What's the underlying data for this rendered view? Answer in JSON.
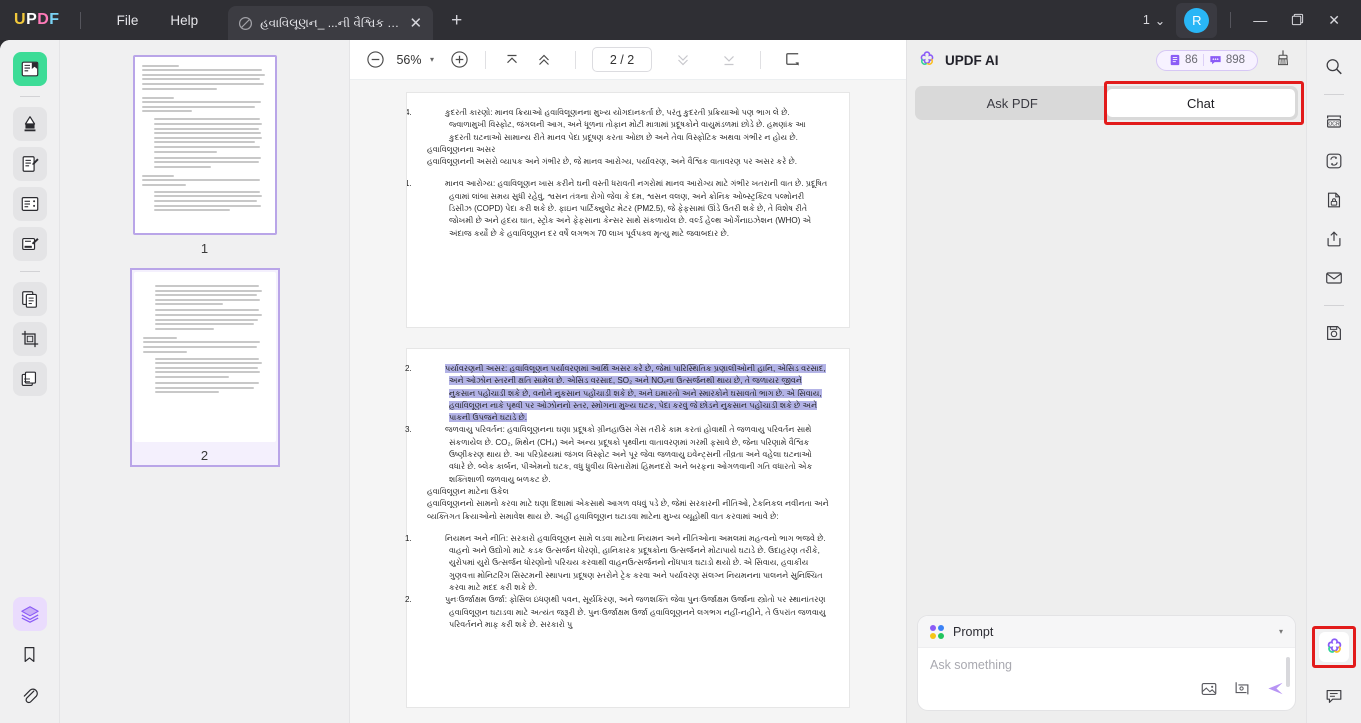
{
  "titlebar": {
    "logo_parts": [
      "U",
      "P",
      "D",
      "F"
    ],
    "menus": [
      {
        "label": "File",
        "name": "menu-file"
      },
      {
        "label": "Help",
        "name": "menu-help"
      }
    ],
    "tab": {
      "title": "હવાવિલૂણન_ ...ની વૈશ્વિક ચિંતા",
      "close_label": "✕",
      "icon": "slash-circle-icon"
    },
    "new_tab_label": "+",
    "window_count": "1",
    "window_count_caret": "⌄",
    "avatar_initial": "R",
    "minimize_label": "—",
    "maximize_label": "❐",
    "close_label": "✕"
  },
  "left_rail": {
    "items": [
      {
        "name": "sidebar-reader-tool",
        "icon": "reader-icon",
        "state": "active"
      },
      {
        "name": "sidebar-annotate-tool",
        "icon": "highlighter-icon",
        "state": "normal"
      },
      {
        "name": "sidebar-edit-pdf-tool",
        "icon": "edit-document-icon",
        "state": "normal"
      },
      {
        "name": "sidebar-form-tool",
        "icon": "form-icon",
        "state": "normal"
      },
      {
        "name": "sidebar-sign-tool",
        "icon": "signature-icon",
        "state": "normal"
      },
      {
        "name": "sidebar-page-tool",
        "icon": "pages-icon",
        "state": "normal"
      },
      {
        "name": "sidebar-crop-tool",
        "icon": "crop-icon",
        "state": "normal"
      },
      {
        "name": "sidebar-organize-tool",
        "icon": "organize-pages-icon",
        "state": "normal"
      }
    ],
    "bottom_items": [
      {
        "name": "sidebar-layers-panel",
        "icon": "layers-icon",
        "state": "purple"
      },
      {
        "name": "sidebar-bookmarks-panel",
        "icon": "bookmark-icon",
        "state": "plain"
      },
      {
        "name": "sidebar-attachments-panel",
        "icon": "paperclip-icon",
        "state": "plain"
      }
    ]
  },
  "thumbnails": {
    "pages": [
      {
        "label": "1",
        "selected": false,
        "name": "thumbnail-page-1"
      },
      {
        "label": "2",
        "selected": true,
        "name": "thumbnail-page-2"
      }
    ]
  },
  "doc_toolbar": {
    "zoom_out_label": "−",
    "zoom_value": "56%",
    "zoom_caret": "▾",
    "zoom_in_label": "+",
    "first_page_icon": "top-of-page-icon",
    "prev_page_icon": "chevron-up-icon",
    "page_indicator": "2 / 2",
    "next_page_icon": "chevron-down-icon",
    "last_page_icon": "bottom-of-page-icon",
    "view_mode_icon": "page-view-mode-icon"
  },
  "document": {
    "page1": {
      "item4": "કુદરતી કારણો: માનવ ક્રિયાઓ હવાવિલૂણનના મુખ્ય યોગદાનકર્તા છે, પરંતુ કુદરતી પ્રક્રિયાઓ પણ ભાગ લે છે. જ્વાળામુખી વિસ્ફોટ, જંગલની આગ, અને ધૂળના તોફાન મોટી માત્રામાં પ્રદૂષકોને વાયુમંડળમાં છોડે છે. હમણાંક આ કુદરતી ઘટનાઓ સામાન્ય રીતે માનવ પેદા પ્રદૂષણ કરતા ઓછા છે અને તેવા વિસ્ફોટિક અથવા ગંભીર ન હોય છે.",
      "heading": "હવાવિલૂણનના અસર",
      "para": "હવાવિલૂણનની અસરો વ્યાપક અને ગંભીર છે, જે માનવ આરોગ્ય, પર્યાવરણ, અને વૈશ્વિક વાતાવરણ પર અસર કરે છે.",
      "item1": "માનવ આરોગ્ય: હવાવિલૂણન ખાસ કરીને ઘની વસ્તી ધરાવતી નગરોમાં માનવ આરોગ્ય માટે ગંભીર ખતરાની વાત છે. પ્રદૂષિત હવામાં લાંબા સમય સુધી રહેવું, શ્વસન તંત્રના રોગો જેવા કે દમ, શ્વસન વલણ, અને ક્રોનિક ઓબ્સ્ટ્રક્ટિવ પલ્મોનરી ડિસીઝ (COPD) પેદા કરી શકે છે. ફાઇન પાર્ટિક્યુલેટ મેટર (PM2.5), જે ફેફસામાં ઊંડે ઉતરી શકે છે, તે વિશેષ રીતે જોખમી છે અને હૃદય ઘાત, સ્ટ્રોક અને ફેફસાના કેન્સર સાથે સંકળાયેલ છે. વર્લ્ડ હેલ્થ ઓર્ગેનાઇઝેશન (WHO) એ અંદાજ કર્યો છે કે હવાવિલૂણન દર વર્ષે લગભગ 70 લાખ પૂર્વપક્વ મૃત્યુ માટે જવાબદાર છે."
    },
    "page2": {
      "item2_highlighted": "પર્યાવરણની અસર: હવાવિલૂણન પર્યાવરણમાં આર્થિ અસર કરે છે, જેમાં પારિસ્થિતિક પ્રણાલીઓની હાનિ, એસિડ વરસાદ, અને ઓઝોન સ્તરની ક્ષતિ સામેલ છે. એસિડ વરસાદ, SO₂ અને NOₓના ઉત્સર્જનથી થાય છે, તે જળાયર જીવને નુકસાન પહોંચાડી શકે છે, વનોને નુકસાન પહોંચાડી શકે છે, અને ઇમારતો અને સ્મારકોને ઘસાવતો ભાગ છે. એ સિવાય, હવાવિલૂણન નાકે પૃથ્વી પર ઓઝોનનો સ્તર, સ્મોગના મુખ્ય ઘટક, પેદા કરવું જે છોડને નુકસાન પહોંચાડી શકે છે અને પાકની ઉપજને ઘટાડે છે.",
      "item3": "જળવાયુ પરિવર્તન: હવાવિલૂણનના ઘણા પ્રદૂષકો ગ્રીનહાઉસ ગેસ તરીકે કામ કરતાં હોવાથી તે જળવાયુ પરિવર્તન સાથે સંકળાયેલ છે. CO₂, મિથેન (CH₄) અને અન્ય પ્રદૂષકો પૃથ્વીના વાતાવરણમાં ગરમી ફસાવે છે, જેના પરિણામે વૈશ્વિક ઉષ્ણીકરણ થાય છે. આ પરિપ્રેક્ષ્યમાં જંગલ વિસ્ફોટ અને પૂર જેવા જળવાયુ ઇવેન્ટ્સની તીવ્રતા અને વહેલા ઘટનાઓ વધારે છે. બ્લેક કાર્બન, પીએમનો ઘટક, વધુ ધ્રુવીય વિસ્તારોમાં હિમનદરો અને બરફના ઓગળવાની ગતિ વધારતો એક શક્તિશાળી જળવાયુ બળકટ છે.",
      "heading": "હવાવિલૂણન માટેના ઉકેલ",
      "para": "હવાવિલૂણનનો સામનો કરવા માટે ઘણા દિશામાં એકસાથે આગળ વધવું પડે છે, જેમાં સરકારની નીતિઓ, ટેકનિકલ નવીનતા અને વ્યક્તિગત ક્રિયાઓનો સમાવેશ થાય છે. અહીં હવાવિલૂણન ઘટાડવા માટેના મુખ્ય વ્યૂહોથી વાત કરવામાં આવે છે:",
      "item1": "નિયમન અને નીતિ: સરકારો હવાવિલૂણન સામે લડવા માટેના નિયમન અને નીતિઓના અમલમાં મહત્વનો ભાગ ભજવે છે. વાહનો અને ઉદ્યોગો માટે કડક ઉત્સર્જન ધોરણો, હાનિકારક પ્રદૂષકોના ઉત્સર્જનને મોટાપાયે ઘટાડે છે. ઉદાહરણ તરીકે, યુરોપમાં યુરો ઉત્સર્જન ધોરણોનો પરિચય કરવાથી વાહનઉત્સર્જનનો નોંધપાત્ર ઘટાડો થયો છે. એ સિવાય, હવાકીય ગુણવત્તા મોનિટરિંગ સિસ્ટમની સ્થાપના પ્રદૂષણ સ્તરોને ટ્રેક કરવા અને પર્યાવરણ સંલગ્ન નિયમનના પાલનને સુનિશ્ચિત કરવા માટે મદદ કરી શકે છે.",
      "item2": "પુનઃઉર્જાક્ષમ ઉર્જા: ફોસિલ ઇંધણથી પવન, સૂર્યકિરણ, અને જળશક્તિ જેવા પુનઃઉર્જાક્ષમ ઉર્જાના સ્ત્રોતો પર સ્થાનાંતરણ હવાવિલૂણન ઘટાડવા માટે અત્યંત જરૂરી છે. પુનઃઉર્જાક્ષમ ઉર્જા હવાવિલૂણનને લગભગ નહીં-નહીને, તે ઉપરાંત જળવાયુ પરિવર્તનને માફ કરી શકે છે. સરકારો પુ"
    }
  },
  "ai_panel": {
    "logo_icon": "updf-ai-clover-icon",
    "title": "UPDF AI",
    "badges": [
      {
        "icon": "document-count-icon",
        "value": "86",
        "name": "badge-document-count"
      },
      {
        "icon": "chat-count-icon",
        "value": "898",
        "name": "badge-chat-count"
      }
    ],
    "clean_icon": "broom-icon",
    "tabs": [
      {
        "label": "Ask PDF",
        "selected": false,
        "name": "tab-ask-pdf"
      },
      {
        "label": "Chat",
        "selected": true,
        "name": "tab-chat"
      }
    ],
    "composer": {
      "dot_colors": [
        "#8b5cf6",
        "#3b82f6",
        "#f5c518",
        "#22c55e"
      ],
      "label": "Prompt",
      "caret": "▾",
      "placeholder": "Ask something",
      "actions": [
        {
          "icon": "image-upload-icon",
          "name": "attach-image-button"
        },
        {
          "icon": "screenshot-crop-icon",
          "name": "screenshot-button"
        },
        {
          "icon": "send-icon",
          "name": "send-button"
        }
      ]
    }
  },
  "right_rail": {
    "items": [
      {
        "name": "right-search-tool",
        "icon": "search-icon"
      },
      {
        "name": "right-ocr-tool",
        "icon": "ocr-icon"
      },
      {
        "name": "right-convert-tool",
        "icon": "convert-icon"
      },
      {
        "name": "right-protect-tool",
        "icon": "protect-document-icon"
      },
      {
        "name": "right-share-tool",
        "icon": "share-icon"
      },
      {
        "name": "right-email-tool",
        "icon": "email-icon"
      },
      {
        "name": "right-save-tool",
        "icon": "save-icon"
      }
    ],
    "bottom_items": [
      {
        "name": "right-updf-ai-tool",
        "icon": "updf-ai-clover-icon"
      },
      {
        "name": "right-comment-tool",
        "icon": "comment-icon"
      }
    ]
  },
  "colors": {
    "accent_purple": "#8b5cf6",
    "highlight_selection": "#b3b3e6",
    "annotation_red": "#e21b1b",
    "active_green": "#3ddc97",
    "avatar_blue": "#29b6f6"
  }
}
